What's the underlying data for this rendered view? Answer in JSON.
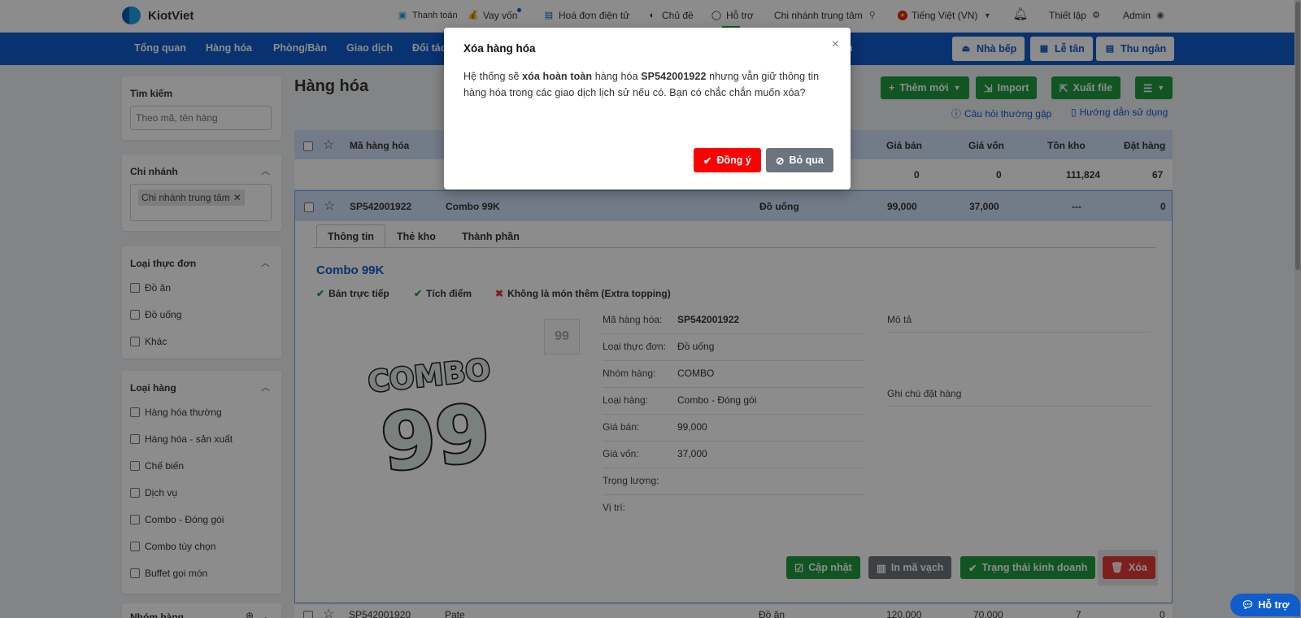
{
  "brand": {
    "logo_text": "KiotViet"
  },
  "topbar": {
    "payment": "Thanh toán",
    "loan": "Vay vốn",
    "einvoice": "Hoá đơn điện tử",
    "theme": "Chủ đề",
    "support": "Hỗ trợ",
    "branch": "Chi nhánh trung tâm",
    "language": "Tiếng Việt (VN)",
    "settings": "Thiết lập",
    "user": "Admin"
  },
  "nav": {
    "items": [
      "Tổng quan",
      "Hàng hóa",
      "Phòng/Bàn",
      "Giao dịch",
      "Đối tác",
      "n"
    ],
    "kitchen": "Nhà bếp",
    "reception": "Lễ tân",
    "cashier": "Thu ngân"
  },
  "sidebar": {
    "search": {
      "title": "Tìm kiếm",
      "placeholder": "Theo mã, tên hàng"
    },
    "branch": {
      "title": "Chi nhánh",
      "tag": "Chi nhánh trung tâm"
    },
    "menu_type": {
      "title": "Loại thực đơn",
      "options": [
        "Đồ ăn",
        "Đồ uống",
        "Khác"
      ]
    },
    "item_type": {
      "title": "Loại hàng",
      "options": [
        "Hàng hóa thường",
        "Hàng hóa - sản xuất",
        "Chế biến",
        "Dịch vụ",
        "Combo - Đóng gói",
        "Combo tùy chọn",
        "Buffet gọi món"
      ]
    },
    "group": {
      "title": "Nhóm hàng"
    }
  },
  "main": {
    "title": "Hàng hóa",
    "buttons": {
      "add": "Thêm mới",
      "import": "Import",
      "export": "Xuất file"
    },
    "links": {
      "faq": "Câu hỏi thường gặp",
      "guide": "Hướng dẫn sử dụng"
    }
  },
  "table": {
    "headers": {
      "code": "Mã hàng hóa",
      "price": "Giá bán",
      "cost": "Giá vốn",
      "stock": "Tồn kho",
      "ordered": "Đặt hàng"
    },
    "summary": {
      "price": "0",
      "cost": "0",
      "stock": "111,824",
      "ordered": "67"
    },
    "selected_row": {
      "code": "SP542001922",
      "name": "Combo 99K",
      "category": "Đồ uống",
      "price": "99,000",
      "cost": "37,000",
      "stock": "---",
      "ordered": "0"
    },
    "next_row": {
      "code": "SP542001920",
      "name": "Pate",
      "category": "Đồ ăn",
      "price": "120,000",
      "cost": "70,000",
      "stock": "7",
      "ordered": "0"
    }
  },
  "detail": {
    "tabs": [
      "Thông tin",
      "Thẻ kho",
      "Thành phần"
    ],
    "name": "Combo 99K",
    "flags": [
      {
        "label": "Bán trực tiếp",
        "on": true
      },
      {
        "label": "Tích điểm",
        "on": true
      },
      {
        "label": "Không là món thêm (Extra topping)",
        "on": false
      }
    ],
    "image_text": [
      "COMBO",
      "99"
    ],
    "thumb_text": "99",
    "fields": [
      {
        "label": "Mã hàng hóa:",
        "value": "SP542001922"
      },
      {
        "label": "Loại thực đơn:",
        "value": "Đồ uống"
      },
      {
        "label": "Nhóm hàng:",
        "value": "COMBO"
      },
      {
        "label": "Loại hàng:",
        "value": "Combo - Đóng gói"
      },
      {
        "label": "Giá bán:",
        "value": "99,000"
      },
      {
        "label": "Giá vốn:",
        "value": "37,000"
      },
      {
        "label": "Trọng lượng:",
        "value": ""
      },
      {
        "label": "Vị trí:",
        "value": ""
      }
    ],
    "description_label": "Mô tả",
    "order_note_label": "Ghi chú đặt hàng",
    "actions": {
      "update": "Cập nhật",
      "barcode": "In mã vạch",
      "status": "Trạng thái kinh doanh",
      "delete": "Xóa"
    }
  },
  "modal": {
    "title": "Xóa hàng hóa",
    "text_1": "Hệ thống sẽ ",
    "text_bold_1": "xóa hoàn toàn",
    "text_2": " hàng hóa ",
    "text_bold_2": "SP542001922",
    "text_3": " nhưng vẫn giữ thông tin hàng hóa trong các giao dịch lịch sử nếu có. Bạn có chắc chắn muốn xóa?",
    "confirm": "Đồng ý",
    "cancel": "Bỏ qua"
  },
  "help_bubble": "Hỗ trợ",
  "colors": {
    "primary": "#0f5ccc",
    "success": "#1e9c3f",
    "danger": "#e53935",
    "confirm": "#ff0000",
    "muted": "#6c757d"
  }
}
